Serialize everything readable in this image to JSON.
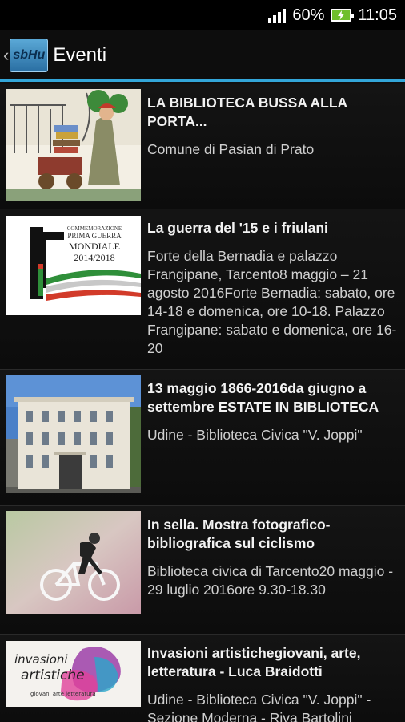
{
  "status": {
    "battery": "60%",
    "time": "11:05"
  },
  "actionbar": {
    "logo_text": "sbHu",
    "title": "Eventi"
  },
  "events": [
    {
      "title": "LA BIBLIOTECA BUSSA ALLA PORTA...",
      "subtitle": "Comune di Pasian di Prato"
    },
    {
      "title": "La guerra del '15 e i friulani",
      "subtitle": "Forte della Bernadia e palazzo Frangipane, Tarcento8 maggio – 21 agosto 2016Forte Bernadia: sabato, ore 14-18 e domenica, ore 10-18. Palazzo Frangipane: sabato e domenica, ore 16-20",
      "thumb_text1": "COMMEMORAZIONE",
      "thumb_text2": "PRIMA GUERRA",
      "thumb_text3": "MONDIALE",
      "thumb_text4": "2014/2018"
    },
    {
      "title": "13 maggio 1866-2016da giugno a settembre ESTATE IN BIBLIOTECA",
      "subtitle": "Udine - Biblioteca Civica \"V. Joppi\""
    },
    {
      "title": "In sella. Mostra fotografico-bibliografica sul ciclismo",
      "subtitle": "Biblioteca civica di Tarcento20 maggio - 29 luglio 2016ore 9.30-18.30"
    },
    {
      "title": "Invasioni artistichegiovani, arte, letteratura - Luca Braidotti",
      "subtitle": "Udine - Biblioteca Civica \"V. Joppi\" - Sezione Moderna - Riva Bartolini",
      "thumb_text1": "invasioni",
      "thumb_text2": "artistiche",
      "thumb_text3": "giovani arte letteratura"
    }
  ]
}
